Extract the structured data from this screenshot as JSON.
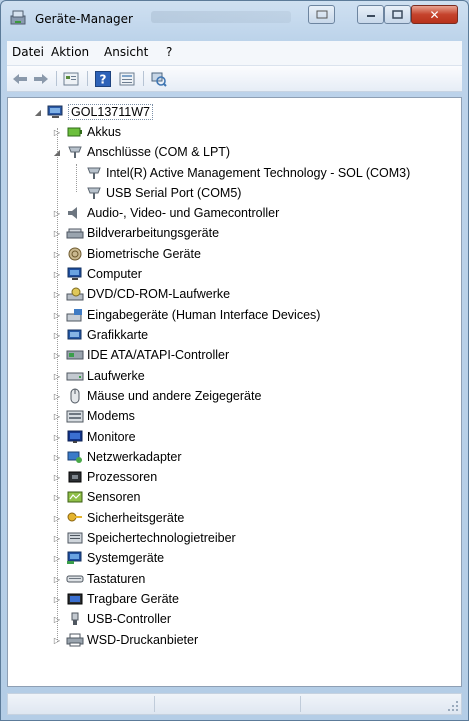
{
  "window": {
    "title": "Geräte-Manager",
    "controls": {
      "minimize": "minimize-button",
      "maximize": "maximize-button",
      "close": "close-button"
    }
  },
  "menu": {
    "items": [
      {
        "label": "Datei"
      },
      {
        "label": "Aktion"
      },
      {
        "label": "Ansicht"
      },
      {
        "label": "?"
      }
    ]
  },
  "toolbar": {
    "buttons": [
      "back-arrow-icon",
      "forward-arrow-icon",
      "properties-icon",
      "help-icon",
      "view-icon",
      "scan-hardware-icon"
    ]
  },
  "tree": {
    "root": "GOL13711W7",
    "items": [
      {
        "label": "Akkus",
        "icon": "battery-icon",
        "expanded": false,
        "level": 1
      },
      {
        "label": "Anschlüsse (COM & LPT)",
        "icon": "port-icon",
        "expanded": true,
        "level": 1
      },
      {
        "label": "Intel(R) Active Management Technology - SOL (COM3)",
        "icon": "port-icon",
        "level": 2
      },
      {
        "label": "USB Serial Port (COM5)",
        "icon": "port-icon",
        "level": 2
      },
      {
        "label": "Audio-, Video- und Gamecontroller",
        "icon": "speaker-icon",
        "expanded": false,
        "level": 1
      },
      {
        "label": "Bildverarbeitungsgeräte",
        "icon": "scanner-icon",
        "expanded": false,
        "level": 1
      },
      {
        "label": "Biometrische Geräte",
        "icon": "fingerprint-icon",
        "expanded": false,
        "level": 1
      },
      {
        "label": "Computer",
        "icon": "computer-icon",
        "expanded": false,
        "level": 1
      },
      {
        "label": "DVD/CD-ROM-Laufwerke",
        "icon": "disc-drive-icon",
        "expanded": false,
        "level": 1
      },
      {
        "label": "Eingabegeräte (Human Interface Devices)",
        "icon": "hid-icon",
        "expanded": false,
        "level": 1
      },
      {
        "label": "Grafikkarte",
        "icon": "display-adapter-icon",
        "expanded": false,
        "level": 1
      },
      {
        "label": "IDE ATA/ATAPI-Controller",
        "icon": "ide-controller-icon",
        "expanded": false,
        "level": 1
      },
      {
        "label": "Laufwerke",
        "icon": "disk-drive-icon",
        "expanded": false,
        "level": 1
      },
      {
        "label": "Mäuse und andere Zeigegeräte",
        "icon": "mouse-icon",
        "expanded": false,
        "level": 1
      },
      {
        "label": "Modems",
        "icon": "modem-icon",
        "expanded": false,
        "level": 1
      },
      {
        "label": "Monitore",
        "icon": "monitor-icon",
        "expanded": false,
        "level": 1
      },
      {
        "label": "Netzwerkadapter",
        "icon": "network-adapter-icon",
        "expanded": false,
        "level": 1
      },
      {
        "label": "Prozessoren",
        "icon": "processor-icon",
        "expanded": false,
        "level": 1
      },
      {
        "label": "Sensoren",
        "icon": "sensor-icon",
        "expanded": false,
        "level": 1
      },
      {
        "label": "Sicherheitsgeräte",
        "icon": "security-key-icon",
        "expanded": false,
        "level": 1
      },
      {
        "label": "Speichertechnologietreiber",
        "icon": "storage-icon",
        "expanded": false,
        "level": 1
      },
      {
        "label": "Systemgeräte",
        "icon": "system-device-icon",
        "expanded": false,
        "level": 1
      },
      {
        "label": "Tastaturen",
        "icon": "keyboard-icon",
        "expanded": false,
        "level": 1
      },
      {
        "label": "Tragbare Geräte",
        "icon": "portable-device-icon",
        "expanded": false,
        "level": 1
      },
      {
        "label": "USB-Controller",
        "icon": "usb-icon",
        "expanded": false,
        "level": 1
      },
      {
        "label": "WSD-Druckanbieter",
        "icon": "printer-icon",
        "expanded": false,
        "level": 1
      }
    ]
  },
  "colors": {
    "title_bg": "#cfe0f1",
    "close_red": "#c5432c",
    "tree_bg": "#ffffff"
  }
}
